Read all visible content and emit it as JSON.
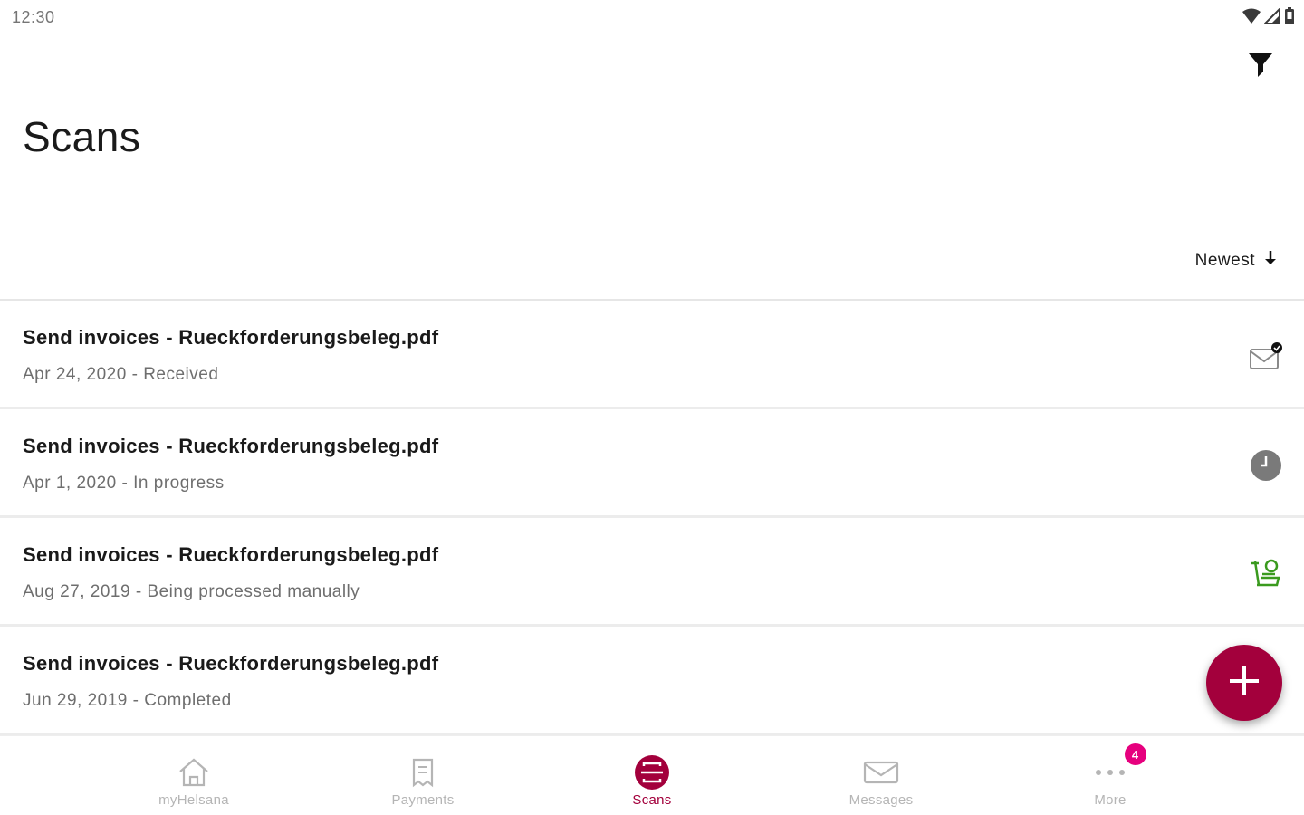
{
  "status_bar": {
    "time": "12:30",
    "icons": [
      "wifi-icon",
      "cell-signal-icon",
      "battery-icon"
    ]
  },
  "header": {
    "title": "Scans",
    "filter_icon": "filter-icon"
  },
  "sort": {
    "label": "Newest",
    "icon": "arrow-down-icon"
  },
  "scans": [
    {
      "title": "Send invoices - Rueckforderungsbeleg.pdf",
      "subtitle": "Apr 24, 2020 - Received",
      "status_icon": "envelope-notification-icon"
    },
    {
      "title": "Send invoices - Rueckforderungsbeleg.pdf",
      "subtitle": "Apr 1, 2020 - In progress",
      "status_icon": "clock-icon"
    },
    {
      "title": "Send invoices - Rueckforderungsbeleg.pdf",
      "subtitle": "Aug 27, 2019 - Being processed manually",
      "status_icon": "manual-processing-icon"
    },
    {
      "title": "Send invoices - Rueckforderungsbeleg.pdf",
      "subtitle": "Jun 29, 2019 - Completed",
      "status_icon": "check-icon"
    }
  ],
  "fab": {
    "icon": "plus-icon"
  },
  "bottom_nav": {
    "tabs": [
      {
        "label": "myHelsana",
        "icon": "home-icon"
      },
      {
        "label": "Payments",
        "icon": "receipt-icon"
      },
      {
        "label": "Scans",
        "icon": "scan-icon",
        "active": true
      },
      {
        "label": "Messages",
        "icon": "envelope-icon"
      },
      {
        "label": "More",
        "icon": "more-dots-icon",
        "badge": "4"
      }
    ]
  },
  "colors": {
    "accent": "#a3003c",
    "badge": "#e6007e",
    "manual_icon": "#3a9a1e",
    "clock_icon": "#7a7a7a"
  }
}
